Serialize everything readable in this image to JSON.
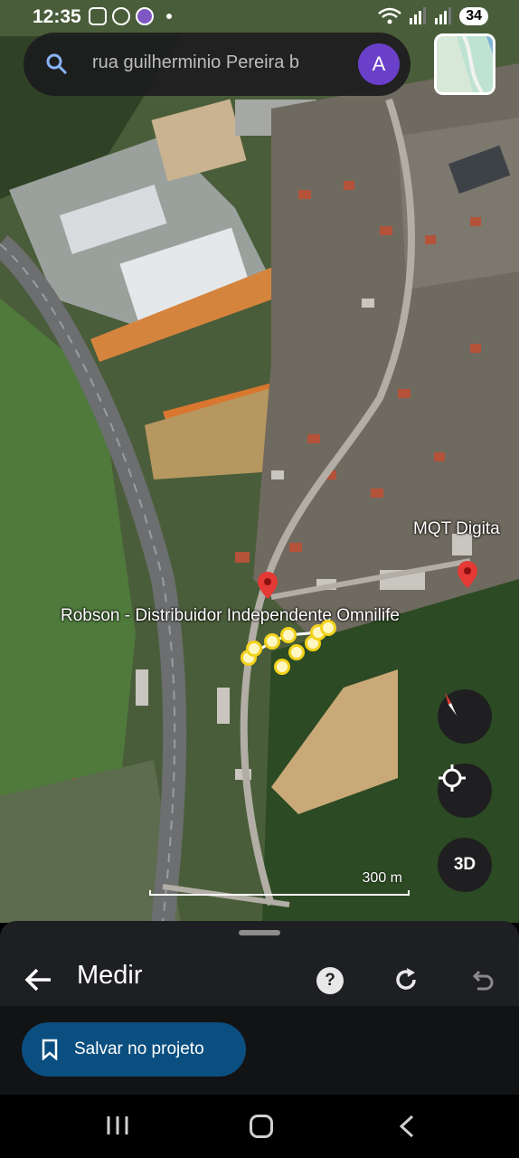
{
  "status_bar": {
    "time": "12:35",
    "battery": "34"
  },
  "search": {
    "query": "rua guilherminio Pereira  b",
    "avatar_letter": "A"
  },
  "map": {
    "labels": {
      "business_a": "Robson - Distribuidor Independente Omnilife",
      "business_b": "MQT Digita"
    },
    "scale": "300 m",
    "view_mode_label": "3D"
  },
  "sheet": {
    "title": "Medir",
    "help_label": "?",
    "save_label": "Salvar no projeto"
  },
  "colors": {
    "accent": "#0b4f80",
    "avatar": "#6a3fc9",
    "pin": "#e53935",
    "measure_point": "#f2d21b"
  }
}
